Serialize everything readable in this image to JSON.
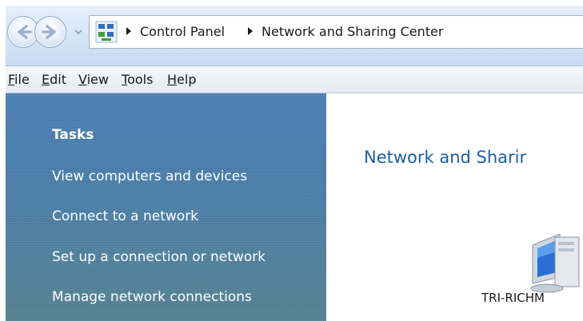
{
  "address_bar": {
    "breadcrumbs": [
      "Control Panel",
      "Network and Sharing Center"
    ],
    "icons": {
      "back": "back-arrow-icon",
      "forward": "forward-arrow-icon",
      "recent": "chevron-down-icon",
      "location": "control-panel-icon"
    }
  },
  "menu": {
    "items": [
      "File",
      "Edit",
      "View",
      "Tools",
      "Help"
    ]
  },
  "tasks": {
    "heading": "Tasks",
    "links": [
      "View computers and devices",
      "Connect to a network",
      "Set up a connection or network",
      "Manage network connections"
    ]
  },
  "main": {
    "title": "Network and Sharir",
    "computer_label": "TRI-RICHM",
    "computer_icon": "computer-icon"
  },
  "colors": {
    "task_pane": "#4d7fb2",
    "title_text": "#1e5ea4",
    "address_bar": "#d7e6f7"
  }
}
